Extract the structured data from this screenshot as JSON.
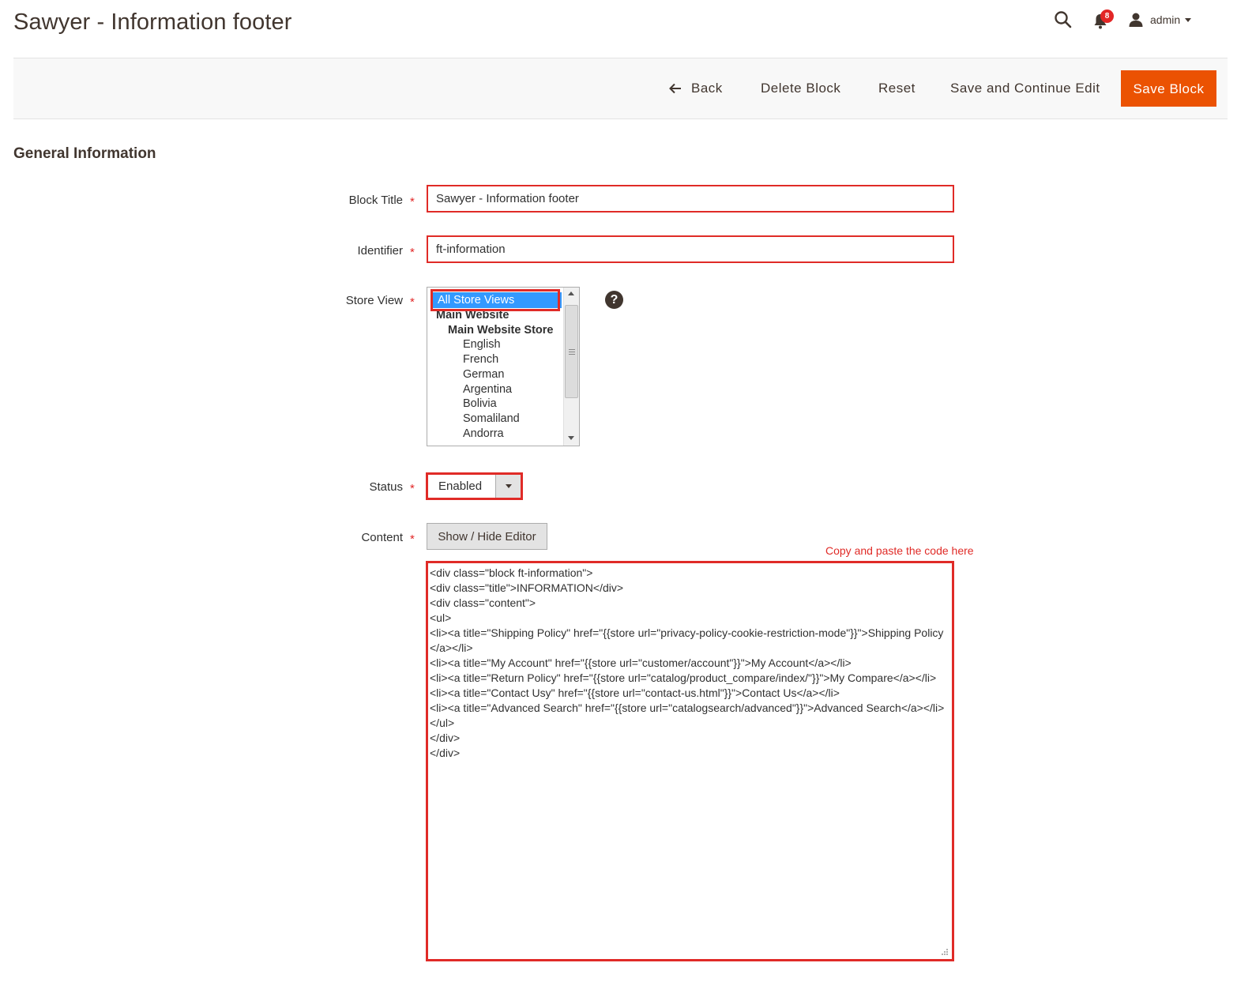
{
  "header": {
    "title": "Sawyer - Information footer",
    "notification_count": "8",
    "user_name": "admin"
  },
  "toolbar": {
    "back_label": "Back",
    "delete_label": "Delete Block",
    "reset_label": "Reset",
    "save_continue_label": "Save and Continue Edit",
    "save_label": "Save Block"
  },
  "section": {
    "title": "General Information"
  },
  "form": {
    "block_title": {
      "label": "Block Title",
      "value": "Sawyer - Information footer"
    },
    "identifier": {
      "label": "Identifier",
      "value": "ft-information"
    },
    "store_view": {
      "label": "Store View",
      "selected": "All Store Views",
      "options": [
        {
          "label": "Main Website",
          "level": 1,
          "bold": true
        },
        {
          "label": "Main Website Store",
          "level": 2,
          "bold": true
        },
        {
          "label": "English",
          "level": 3
        },
        {
          "label": "French",
          "level": 3
        },
        {
          "label": "German",
          "level": 3
        },
        {
          "label": "Argentina",
          "level": 3
        },
        {
          "label": "Bolivia",
          "level": 3
        },
        {
          "label": "Somaliland",
          "level": 3
        },
        {
          "label": "Andorra",
          "level": 3
        }
      ]
    },
    "status": {
      "label": "Status",
      "value": "Enabled"
    },
    "content": {
      "label": "Content",
      "editor_button": "Show / Hide Editor",
      "annotation": "Copy and paste the code here",
      "code": "<div class=\"block ft-information\">\n<div class=\"title\">INFORMATION</div>\n<div class=\"content\">\n<ul>\n<li><a title=\"Shipping Policy\" href=\"{{store url=\"privacy-policy-cookie-restriction-mode\"}}\">Shipping Policy</a></li>\n<li><a title=\"My Account\" href=\"{{store url=\"customer/account\"}}\">My Account</a></li>\n<li><a title=\"Return Policy\" href=\"{{store url=\"catalog/product_compare/index/\"}}\">My Compare</a></li>\n<li><a title=\"Contact Usy\" href=\"{{store url=\"contact-us.html\"}}\">Contact Us</a></li>\n<li><a title=\"Advanced Search\" href=\"{{store url=\"catalogsearch/advanced\"}}\">Advanced Search</a></li>\n</ul>\n</div>\n</div>"
    }
  },
  "colors": {
    "accent": "#eb5202",
    "highlight": "#e02b27",
    "selection": "#3399ff"
  }
}
